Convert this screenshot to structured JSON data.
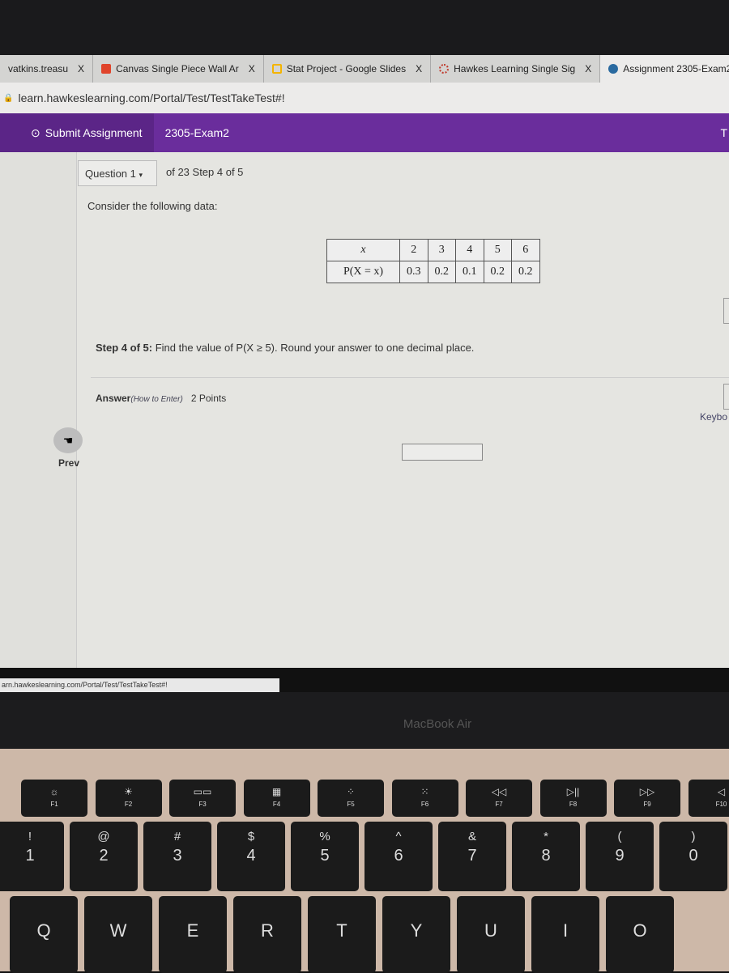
{
  "browser": {
    "tabs": [
      {
        "label": "vatkins.treasu",
        "icon": "tab-favicon",
        "close": "X"
      },
      {
        "label": "Canvas Single Piece Wall Ar",
        "icon": "s-favicon",
        "close": "X",
        "color": "#e0442b"
      },
      {
        "label": "Stat Project - Google Slides",
        "icon": "slides-favicon",
        "close": "X",
        "color": "#f4b400"
      },
      {
        "label": "Hawkes Learning Single Sig",
        "icon": "hawkes-favicon",
        "close": "X",
        "color": "#c0392b"
      },
      {
        "label": "Assignment 2305-Exam2",
        "icon": "hawkes-bird-favicon",
        "color": "#2a6aa0"
      }
    ],
    "url": "learn.hawkeslearning.com/Portal/Test/TestTakeTest#!",
    "status_url": "arn.hawkeslearning.com/Portal/Test/TestTakeTest#!"
  },
  "header": {
    "submit_label": "Submit Assignment",
    "exam_name": "2305-Exam2",
    "right_text": "T",
    "accent": "#6a2d9c"
  },
  "question": {
    "selector": "Question 1",
    "of_text": "of 23 Step 4 of 5",
    "prompt": "Consider the following data:",
    "table": {
      "row_labels": [
        "x",
        "P(X = x)"
      ],
      "x": [
        "2",
        "3",
        "4",
        "5",
        "6"
      ],
      "p": [
        "0.3",
        "0.2",
        "0.1",
        "0.2",
        "0.2"
      ]
    },
    "step_label": "Step 4 of 5:",
    "step_text": " Find the value of P(X ≥ 5). Round your answer to one decimal place.",
    "answer_label": "Answer",
    "how_to_enter": "(How to Enter)",
    "points": "2 Points",
    "answer_value": "",
    "keyboard_link": "Keybo"
  },
  "sidebar": {
    "prev_label": "Prev"
  },
  "laptop": {
    "model": "MacBook Air",
    "fkeys": [
      {
        "icon": "☼",
        "label": "F1"
      },
      {
        "icon": "☀",
        "label": "F2"
      },
      {
        "icon": "▭▭",
        "label": "F3"
      },
      {
        "icon": "▦",
        "label": "F4"
      },
      {
        "icon": "⁘",
        "label": "F5"
      },
      {
        "icon": "⁙",
        "label": "F6"
      },
      {
        "icon": "◁◁",
        "label": "F7"
      },
      {
        "icon": "▷||",
        "label": "F8"
      },
      {
        "icon": "▷▷",
        "label": "F9"
      },
      {
        "icon": "◁",
        "label": "F10"
      }
    ],
    "numkeys": [
      {
        "s": "!",
        "m": "1"
      },
      {
        "s": "@",
        "m": "2"
      },
      {
        "s": "#",
        "m": "3"
      },
      {
        "s": "$",
        "m": "4"
      },
      {
        "s": "%",
        "m": "5"
      },
      {
        "s": "^",
        "m": "6"
      },
      {
        "s": "&",
        "m": "7"
      },
      {
        "s": "*",
        "m": "8"
      },
      {
        "s": "(",
        "m": "9"
      },
      {
        "s": ")",
        "m": "0"
      }
    ],
    "letterkeys": [
      "Q",
      "W",
      "E",
      "R",
      "T",
      "Y",
      "U",
      "I",
      "O"
    ]
  }
}
